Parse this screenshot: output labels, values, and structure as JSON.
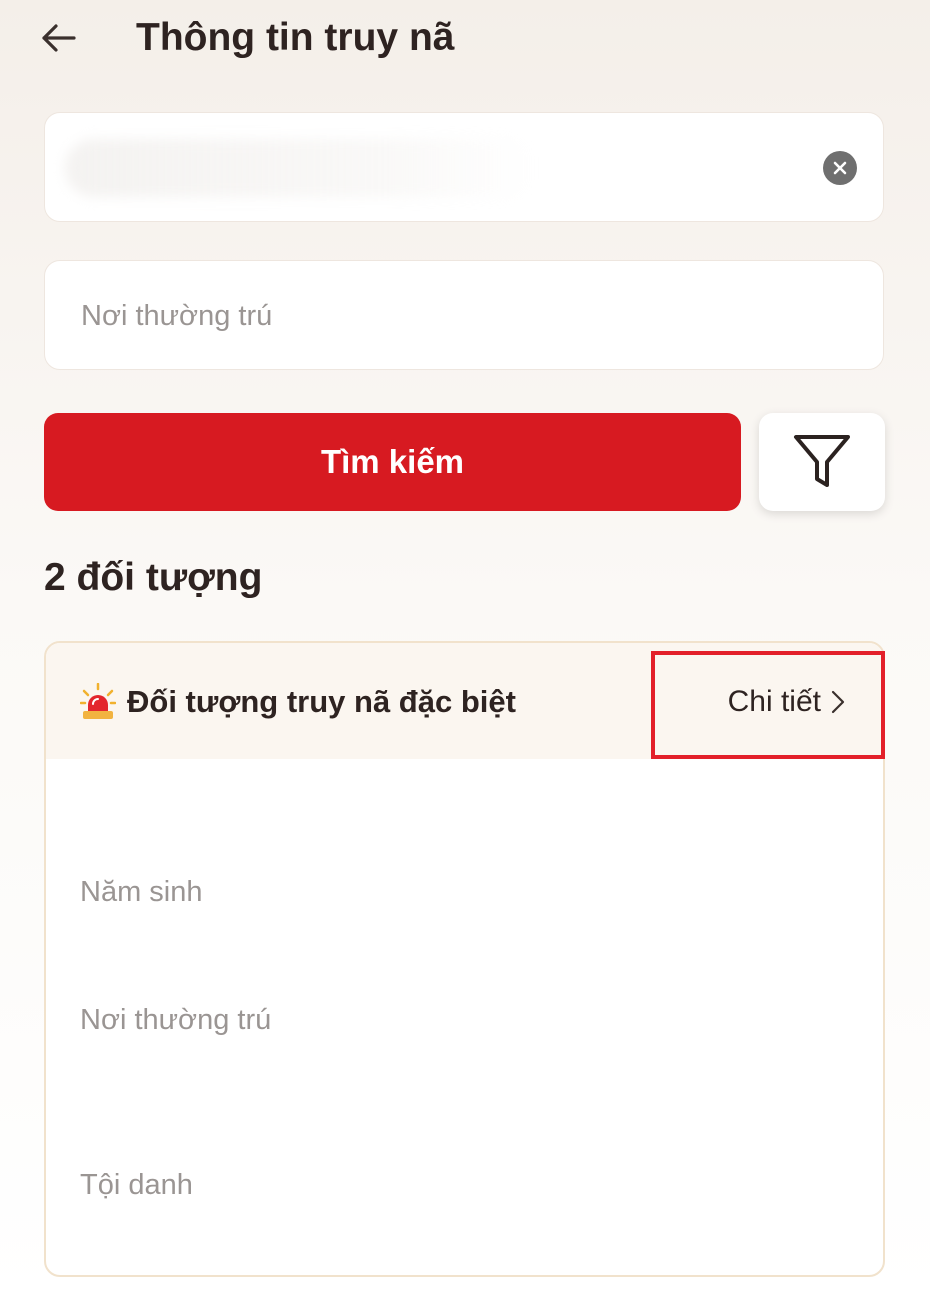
{
  "header": {
    "title": "Thông tin truy nã",
    "back_icon": "arrow-left-icon"
  },
  "search_form": {
    "name_field": {
      "value": "",
      "clear_icon": "clear-circle-icon"
    },
    "residence_field": {
      "placeholder": "Nơi thường trú"
    },
    "search_button_label": "Tìm kiếm",
    "filter_icon": "filter-funnel-icon"
  },
  "results": {
    "count_label": "2 đối tượng",
    "cards": [
      {
        "icon": "siren-icon",
        "title": "Đối tượng truy nã đặc biệt",
        "detail_label": "Chi tiết",
        "detail_icon": "chevron-right-icon",
        "fields": {
          "birth_year_label": "Năm sinh",
          "residence_label": "Nơi thường trú",
          "crime_label": "Tội danh"
        }
      }
    ]
  },
  "colors": {
    "primary_red": "#d71a21",
    "highlight_red": "#e3202a",
    "card_header_bg": "#fbf6f0",
    "text_dark": "#2e2321",
    "text_muted": "#9a9593"
  }
}
